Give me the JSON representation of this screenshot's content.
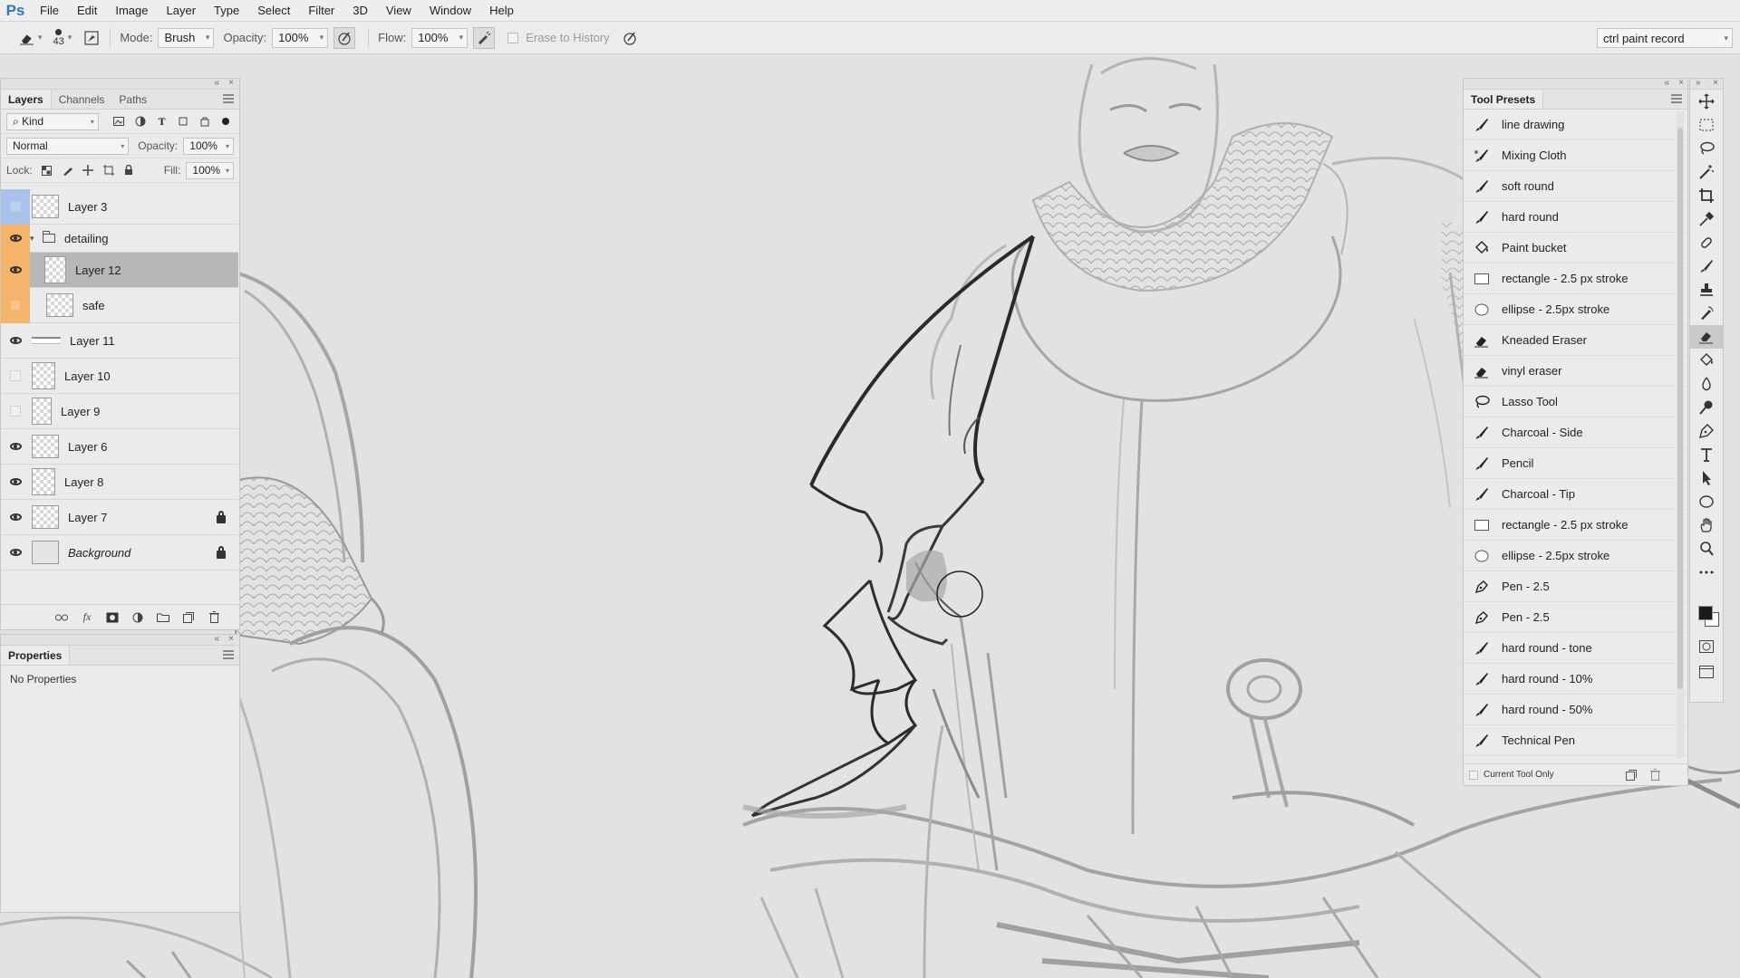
{
  "app": {
    "logo": "Ps"
  },
  "menu": [
    "File",
    "Edit",
    "Image",
    "Layer",
    "Type",
    "Select",
    "Filter",
    "3D",
    "View",
    "Window",
    "Help"
  ],
  "options": {
    "brush_size": "43",
    "mode_label": "Mode:",
    "mode_value": "Brush",
    "opacity_label": "Opacity:",
    "opacity_value": "100%",
    "flow_label": "Flow:",
    "flow_value": "100%",
    "erase_history": "Erase to History",
    "workspace": "ctrl paint record"
  },
  "layers_panel": {
    "tabs": [
      "Layers",
      "Channels",
      "Paths"
    ],
    "filter_kind": "Kind",
    "blend_mode": "Normal",
    "opacity_label": "Opacity:",
    "opacity_value": "100%",
    "lock_label": "Lock:",
    "fill_label": "Fill:",
    "fill_value": "100%",
    "layers": [
      {
        "name": "Layer 3",
        "visible": false,
        "color": "blue"
      },
      {
        "name": "detailing",
        "visible": true,
        "color": "orange",
        "group": true
      },
      {
        "name": "Layer 12",
        "visible": true,
        "color": "orange",
        "selected": true
      },
      {
        "name": "safe",
        "visible": false,
        "color": "orange"
      },
      {
        "name": "Layer 11",
        "visible": true
      },
      {
        "name": "Layer 10",
        "visible": false
      },
      {
        "name": "Layer 9",
        "visible": false
      },
      {
        "name": "Layer 6",
        "visible": true
      },
      {
        "name": "Layer 8",
        "visible": true
      },
      {
        "name": "Layer 7",
        "visible": true,
        "locked": true
      },
      {
        "name": "Background",
        "visible": true,
        "locked": true
      }
    ]
  },
  "properties_panel": {
    "title": "Properties",
    "empty_text": "No Properties"
  },
  "tool_presets": {
    "title": "Tool Presets",
    "items": [
      {
        "label": "line drawing",
        "icon": "brush-icon"
      },
      {
        "label": "Mixing Cloth",
        "icon": "mixer-brush-icon"
      },
      {
        "label": "soft round",
        "icon": "brush-icon"
      },
      {
        "label": "hard round",
        "icon": "brush-icon"
      },
      {
        "label": "Paint bucket",
        "icon": "paint-bucket-icon"
      },
      {
        "label": "rectangle - 2.5 px stroke",
        "icon": "rectangle-icon"
      },
      {
        "label": "ellipse - 2.5px stroke",
        "icon": "ellipse-icon"
      },
      {
        "label": "Kneaded Eraser",
        "icon": "eraser-icon"
      },
      {
        "label": "vinyl eraser",
        "icon": "eraser-icon"
      },
      {
        "label": "Lasso Tool",
        "icon": "lasso-icon"
      },
      {
        "label": "Charcoal - Side",
        "icon": "brush-icon"
      },
      {
        "label": "Pencil",
        "icon": "brush-icon"
      },
      {
        "label": "Charcoal - Tip",
        "icon": "brush-icon"
      },
      {
        "label": "rectangle - 2.5 px stroke",
        "icon": "rectangle-icon"
      },
      {
        "label": "ellipse - 2.5px stroke",
        "icon": "ellipse-icon"
      },
      {
        "label": "Pen - 2.5",
        "icon": "pen-icon"
      },
      {
        "label": "Pen - 2.5",
        "icon": "pen-icon"
      },
      {
        "label": "hard round - tone",
        "icon": "brush-icon"
      },
      {
        "label": "hard round - 10%",
        "icon": "brush-icon"
      },
      {
        "label": "hard round - 50%",
        "icon": "brush-icon"
      },
      {
        "label": "Technical Pen",
        "icon": "brush-icon"
      }
    ],
    "current_tool_only": "Current Tool Only"
  },
  "tools": [
    "move-tool-icon",
    "marquee-tool-icon",
    "lasso-tool-icon",
    "magic-wand-tool-icon",
    "crop-tool-icon",
    "eyedropper-tool-icon",
    "healing-brush-tool-icon",
    "brush-tool-icon",
    "clone-stamp-tool-icon",
    "history-brush-tool-icon",
    "eraser-tool-icon",
    "paint-bucket-tool-icon",
    "blur-tool-icon",
    "dodge-tool-icon",
    "pen-tool-icon",
    "type-tool-icon",
    "path-selection-tool-icon",
    "ellipse-tool-icon",
    "hand-tool-icon",
    "zoom-tool-icon",
    "more-tools-icon"
  ],
  "colors": {
    "accent_orange": "#f6b36a",
    "accent_blue": "#a9c2ec",
    "selected_row": "#b7b7b7",
    "foreground": "#1a1a1a",
    "background": "#ffffff"
  }
}
